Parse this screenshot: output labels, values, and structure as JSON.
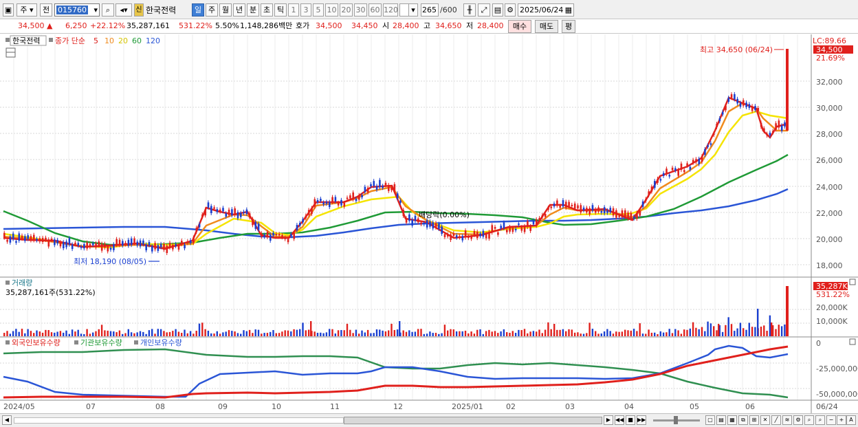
{
  "toolbar": {
    "market": "주",
    "prefix": "전",
    "code": "015760",
    "credit_badge": "신",
    "stock_name": "한국전력",
    "periods": [
      "일",
      "주",
      "월",
      "년",
      "분",
      "초",
      "틱"
    ],
    "active_period": "일",
    "intervals": [
      "1",
      "3",
      "5",
      "10",
      "20",
      "30",
      "60",
      "120"
    ],
    "count": "265",
    "count_max": "/600",
    "date": "2025/06/24"
  },
  "quote": {
    "price": "34,500",
    "change": "6,250",
    "change_pct": "+22.12%",
    "volume": "35,287,161",
    "volume_ratio": "531.22%",
    "turnover": "5.50%",
    "amount": "1,148,286백만",
    "bid_label": "호가",
    "ask": "34,500",
    "bid": "34,450",
    "open_label": "시",
    "open": "28,400",
    "high_label": "고",
    "high": "34,650",
    "low_label": "저",
    "low": "28,400",
    "buy_button": "매수",
    "sell_button": "매도",
    "avg_button": "평"
  },
  "price_panel": {
    "name": "한국전력",
    "ma_label": "종가 단순",
    "ma_periods": [
      "5",
      "10",
      "20",
      "60",
      "120"
    ],
    "lc_label": "LC:89.66",
    "current_tag": "34,500",
    "current_pct": "21.69%",
    "high_annotation": "최고 34,650 (06/24)",
    "low_annotation": "최저 18,190 (08/05)",
    "dividend_annotation": "배당락(0.00%)",
    "y_ticks": [
      "32,000",
      "30,000",
      "28,000",
      "26,000",
      "24,000",
      "22,000",
      "20,000",
      "18,000"
    ]
  },
  "volume_panel": {
    "title": "거래량",
    "value_text": "35,287,161주(531.22%)",
    "current_tag": "35,287K",
    "current_pct": "531.22%",
    "y_ticks": [
      "20,000K",
      "10,000K"
    ]
  },
  "holdings_panel": {
    "legend": [
      "외국인보유수량",
      "기관보유수량",
      "개인보유수량"
    ],
    "y_ticks": [
      "0",
      "-25,000,000",
      "-50,000,000"
    ]
  },
  "x_axis": [
    "2024/05",
    "07",
    "08",
    "09",
    "10",
    "11",
    "12",
    "2025/01",
    "02",
    "03",
    "04",
    "05",
    "06",
    "06/24"
  ],
  "colors": {
    "ma5": "#e0201c",
    "ma10": "#f08a1c",
    "ma20": "#f5e400",
    "ma60": "#1f9a36",
    "ma120": "#2a55d6",
    "up": "#e0201c",
    "down": "#1a3fd0"
  }
}
